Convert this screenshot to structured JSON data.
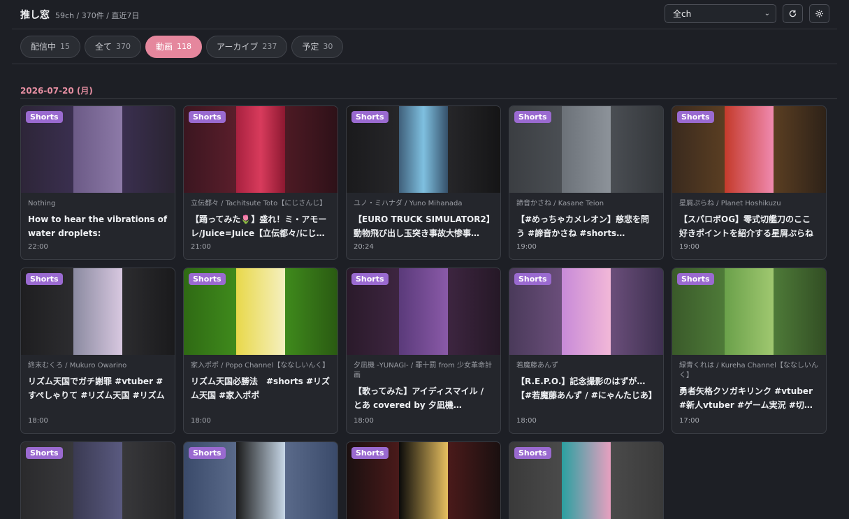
{
  "header": {
    "title": "推し窓",
    "subtitle": "59ch / 370件 / 直近7日",
    "channel_select": "全ch",
    "refresh_icon": "refresh-icon",
    "settings_icon": "gear-icon"
  },
  "tabs": [
    {
      "label": "配信中",
      "count": "15",
      "active": false
    },
    {
      "label": "全て",
      "count": "370",
      "active": false
    },
    {
      "label": "動画",
      "count": "118",
      "active": true
    },
    {
      "label": "アーカイブ",
      "count": "237",
      "active": false
    },
    {
      "label": "予定",
      "count": "30",
      "active": false
    }
  ],
  "date_heading": "2026-07-20 (月)",
  "badge_label": "Shorts",
  "colors": {
    "background": "#1d1f25",
    "card": "#24262c",
    "accent_pink": "#e5879d",
    "shorts_badge": "#9a6ad0"
  },
  "videos": [
    {
      "channel": "Nothing",
      "title": "How to hear the vibrations of water droplets:",
      "time": "22:00"
    },
    {
      "channel": "立伝都々 / Tachitsute Toto【にじさんじ】",
      "title": "【踊ってみた🌷】盛れ！ミ・アモーレ/Juice=Juice【立伝都々/にじさんじ】",
      "time": "21:00"
    },
    {
      "channel": "ユノ・ミハナダ / Yuno Mihanada",
      "title": "【EURO TRUCK SIMULATOR2】動物飛び出し玉突き事故大惨事…",
      "time": "20:24"
    },
    {
      "channel": "諦音かさね / Kasane Teion",
      "title": "【#めっちゃカメレオン】慈悲を問う #諦音かさね #shorts #vtuber",
      "time": "19:00"
    },
    {
      "channel": "星屑ぷらね / Planet Hoshikuzu",
      "title": "【スパロボOG】零式切艦刀のここ好きポイントを紹介する星屑ぷらね",
      "time": "19:00"
    },
    {
      "channel": "終末むくろ / Mukuro Owarino",
      "title": "リズム天国でガチ謝罪 #vtuber #すぺしゃりて #リズム天国 #リズム",
      "time": "18:00"
    },
    {
      "channel": "家入ポポ / Popo Channel【ななしいんく】",
      "title": "リズム天国必勝法　#shorts #リズム天国 #家入ポポ",
      "time": "18:00"
    },
    {
      "channel": "夕凪機 -YUNAGI- / 罪十罰 from 少女革命計画",
      "title": "【歌ってみた】アイディスマイル / とあ covered by 夕凪機×CONTRADICTION",
      "time": "18:00"
    },
    {
      "channel": "若魔藤あんず",
      "title": "【R.E.P.O.】記念撮影のはずが…【#若魔藤あんず / #にゃんたじあ】",
      "time": "18:00"
    },
    {
      "channel": "緑青くれは / Kureha Channel【ななしいんく】",
      "title": "勇者矢格クソガキリンク #vtuber #新人vtuber #ゲーム実況 #切り抜き",
      "time": "17:00"
    },
    {
      "channel": "",
      "title": "",
      "time": ""
    },
    {
      "channel": "",
      "title": "",
      "time": ""
    },
    {
      "channel": "",
      "title": "",
      "time": ""
    },
    {
      "channel": "",
      "title": "",
      "time": ""
    }
  ]
}
